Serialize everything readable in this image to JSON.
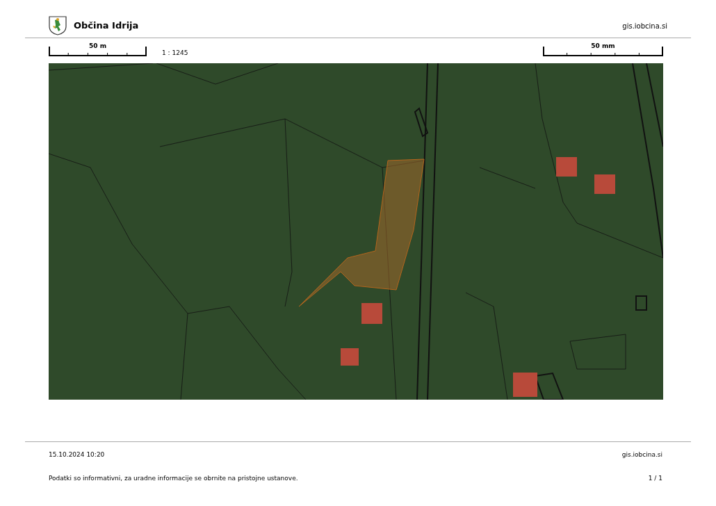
{
  "header": {
    "title": "Občina Idrija",
    "site": "gis.iobcina.si"
  },
  "scale": {
    "left_bar_label": "50 m",
    "ratio": "1 : 1245",
    "right_bar_label": "50 mm"
  },
  "footer": {
    "timestamp": "15.10.2024 10:20",
    "site": "gis.iobcina.si",
    "disclaimer": "Podatki so informativni, za uradne informacije se obrnite na pristojne ustanove.",
    "page": "1 / 1"
  }
}
